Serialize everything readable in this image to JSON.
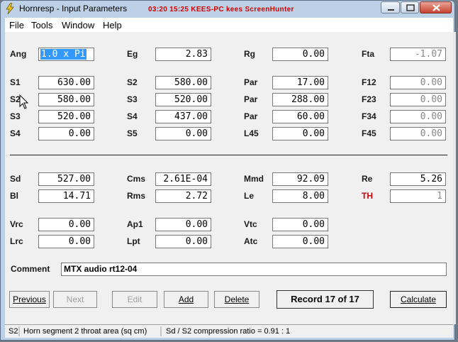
{
  "window": {
    "title": "Hornresp - Input Parameters",
    "overlay": "03:20  15:25  KEES-PC  kees  ScreenHunter"
  },
  "menu": [
    "File",
    "Tools",
    "Window",
    "Help"
  ],
  "rows": [
    {
      "cells": [
        {
          "label": "Ang",
          "value": "1.0 x Pi",
          "selected": true
        },
        {
          "label": "Eg",
          "value": "2.83"
        },
        {
          "label": "Rg",
          "value": "0.00"
        },
        {
          "label": "Fta",
          "value": "-1.07",
          "disabled": true
        }
      ]
    },
    {
      "cells": [
        {
          "label": "S1",
          "value": "630.00"
        },
        {
          "label": "S2",
          "value": "580.00"
        },
        {
          "label": "Par",
          "value": "17.00"
        },
        {
          "label": "F12",
          "value": "0.00",
          "disabled": true
        }
      ]
    },
    {
      "cells": [
        {
          "label": "S2",
          "value": "580.00"
        },
        {
          "label": "S3",
          "value": "520.00"
        },
        {
          "label": "Par",
          "value": "288.00"
        },
        {
          "label": "F23",
          "value": "0.00",
          "disabled": true
        }
      ]
    },
    {
      "cells": [
        {
          "label": "S3",
          "value": "520.00"
        },
        {
          "label": "S4",
          "value": "437.00"
        },
        {
          "label": "Par",
          "value": "60.00"
        },
        {
          "label": "F34",
          "value": "0.00",
          "disabled": true
        }
      ]
    },
    {
      "cells": [
        {
          "label": "S4",
          "value": "0.00"
        },
        {
          "label": "S5",
          "value": "0.00"
        },
        {
          "label": "L45",
          "value": "0.00"
        },
        {
          "label": "F45",
          "value": "0.00",
          "disabled": true
        }
      ]
    },
    {
      "cells": [
        {
          "label": "Sd",
          "value": "527.00"
        },
        {
          "label": "Cms",
          "value": "2.61E-04"
        },
        {
          "label": "Mmd",
          "value": "92.09"
        },
        {
          "label": "Re",
          "value": "5.26"
        }
      ]
    },
    {
      "cells": [
        {
          "label": "Bl",
          "value": "14.71"
        },
        {
          "label": "Rms",
          "value": "2.72"
        },
        {
          "label": "Le",
          "value": "8.00"
        },
        {
          "label": "TH",
          "value": "1",
          "red": true,
          "disabled": true
        }
      ]
    },
    {
      "cells": [
        {
          "label": "Vrc",
          "value": "0.00"
        },
        {
          "label": "Ap1",
          "value": "0.00"
        },
        {
          "label": "Vtc",
          "value": "0.00"
        }
      ]
    },
    {
      "cells": [
        {
          "label": "Lrc",
          "value": "0.00"
        },
        {
          "label": "Lpt",
          "value": "0.00"
        },
        {
          "label": "Atc",
          "value": "0.00"
        }
      ]
    }
  ],
  "comment": {
    "label": "Comment",
    "value": "MTX audio rt12-04"
  },
  "buttons": {
    "previous": "Previous",
    "next": "Next",
    "edit": "Edit",
    "add": "Add",
    "delete": "Delete",
    "calculate": "Calculate"
  },
  "record": "Record 17 of 17",
  "status": {
    "field": "S2",
    "description": "Horn segment 2 throat area  (sq cm)",
    "ratio": "Sd / S2 compression ratio = 0.91 : 1"
  }
}
